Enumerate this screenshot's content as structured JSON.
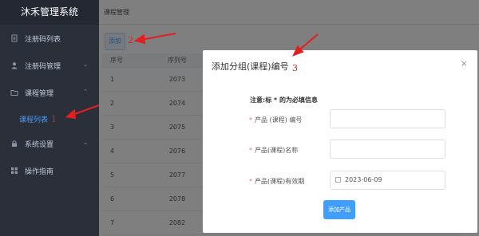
{
  "app": {
    "title": "沐禾管理系统"
  },
  "sidebar": {
    "items": [
      {
        "label": "注册码列表",
        "icon": "document-icon",
        "expandable": false
      },
      {
        "label": "注册码管理",
        "icon": "user-icon",
        "expandable": true
      },
      {
        "label": "课程管理",
        "icon": "folder-icon",
        "expandable": true,
        "expanded": true
      },
      {
        "label": "课程列表",
        "icon": "",
        "sub": true,
        "active": true
      },
      {
        "label": "系统设置",
        "icon": "lock-icon",
        "expandable": true
      },
      {
        "label": "操作指南",
        "icon": "grid-icon",
        "expandable": false
      }
    ]
  },
  "header": {
    "breadcrumb": "课程管理"
  },
  "toolbar": {
    "add_label": "添加"
  },
  "table": {
    "columns": [
      "序号",
      "序列号"
    ],
    "rows": [
      [
        "1",
        "2073"
      ],
      [
        "2",
        "2074"
      ],
      [
        "3",
        "2075"
      ],
      [
        "4",
        "2076"
      ],
      [
        "5",
        "2077"
      ],
      [
        "6",
        "2078"
      ],
      [
        "7",
        "2082"
      ]
    ]
  },
  "dialog": {
    "title": "添加分组(课程)编号",
    "close": "×",
    "notice": "注意:标 * 的为必填信息",
    "fields": [
      {
        "label": "产品 (课程) 编号",
        "value": ""
      },
      {
        "label": "产品(课程)名称",
        "value": ""
      },
      {
        "label": "产品(课程)有效期",
        "value": "2023-06-09"
      }
    ],
    "required_mark": "*",
    "submit_label": "添加产品"
  },
  "annotations": {
    "one": "1",
    "two": "2",
    "three": "3"
  },
  "colors": {
    "sidebar_bg": "#2b2f3a",
    "accent": "#409eff",
    "annotation": "#e02020",
    "required": "#f56c6c"
  }
}
